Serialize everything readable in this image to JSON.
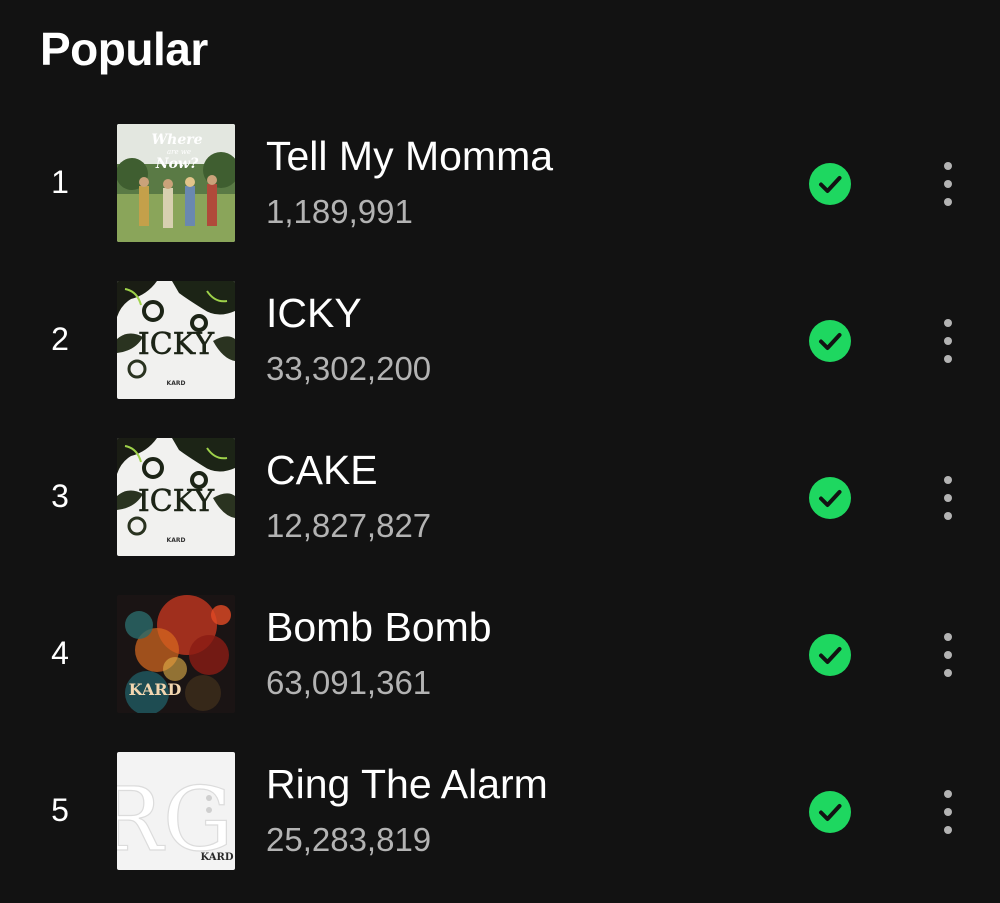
{
  "section": {
    "title": "Popular"
  },
  "colors": {
    "accent": "#1ed760",
    "background": "#121212",
    "secondary_text": "#b3b3b3"
  },
  "tracks": [
    {
      "rank": "1",
      "title": "Tell My Momma",
      "plays": "1,189,991",
      "cover_text": [
        "Where",
        "are we",
        "Now?"
      ],
      "status_icon": "check-circle-icon",
      "menu_icon": "more-vertical-icon"
    },
    {
      "rank": "2",
      "title": "ICKY",
      "plays": "33,302,200",
      "cover_text": [
        "ICKY",
        "KARD"
      ],
      "status_icon": "check-circle-icon",
      "menu_icon": "more-vertical-icon"
    },
    {
      "rank": "3",
      "title": "CAKE",
      "plays": "12,827,827",
      "cover_text": [
        "ICKY",
        "KARD"
      ],
      "status_icon": "check-circle-icon",
      "menu_icon": "more-vertical-icon"
    },
    {
      "rank": "4",
      "title": "Bomb Bomb",
      "plays": "63,091,361",
      "cover_text": [
        "KARD"
      ],
      "status_icon": "check-circle-icon",
      "menu_icon": "more-vertical-icon"
    },
    {
      "rank": "5",
      "title": "Ring The Alarm",
      "plays": "25,283,819",
      "cover_text": [
        "RG",
        "KARD"
      ],
      "status_icon": "check-circle-icon",
      "menu_icon": "more-vertical-icon"
    }
  ]
}
